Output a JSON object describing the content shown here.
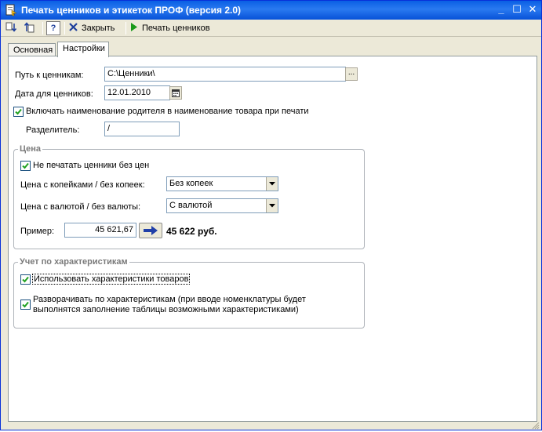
{
  "window": {
    "title": "Печать ценников и этикеток ПРОФ (версия 2.0)",
    "minimize_glyph": "_",
    "maximize_glyph": "☐",
    "close_glyph": "✕"
  },
  "toolbar": {
    "help_label": "?",
    "close_label": "Закрыть",
    "print_label": "Печать ценников"
  },
  "tabs": [
    {
      "label": "Основная"
    },
    {
      "label": "Настройки",
      "active": true
    }
  ],
  "settings": {
    "path_label": "Путь к ценникам:",
    "path_value": "C:\\Ценники\\",
    "browse_label": "...",
    "date_label": "Дата для ценников:",
    "date_value": "12.01.2010",
    "include_parent_label": "Включать наименование родителя в наименование товара при печати",
    "include_parent_checked": true,
    "separator_label": "Разделитель:",
    "separator_value": "/"
  },
  "price_group": {
    "legend": "Цена",
    "no_print_label": "Не печатать ценники без цен",
    "no_print_checked": true,
    "kopecks_label": "Цена с копейками / без копеек:",
    "kopecks_value": "Без копеек",
    "currency_label": "Цена с валютой / без валюты:",
    "currency_value": "С валютой",
    "example_label": "Пример:",
    "example_input": "45 621,67",
    "example_result": "45 622 руб."
  },
  "characteristics_group": {
    "legend": "Учет по характеристикам",
    "use_label": "Использовать характеристики товаров",
    "use_checked": true,
    "expand_label_line1": "Разворачивать по характеристикам (при вводе номенклатуры будет",
    "expand_label_line2": "выполнятся заполнение таблицы возможными характеристиками)",
    "expand_checked": true
  },
  "colors": {
    "titlebar": "#0a5fe4",
    "window_bg": "#ece9d8",
    "print_icon": "#1a9a1a",
    "close_icon": "#1e3f9c",
    "arrow": "#2140a8"
  }
}
